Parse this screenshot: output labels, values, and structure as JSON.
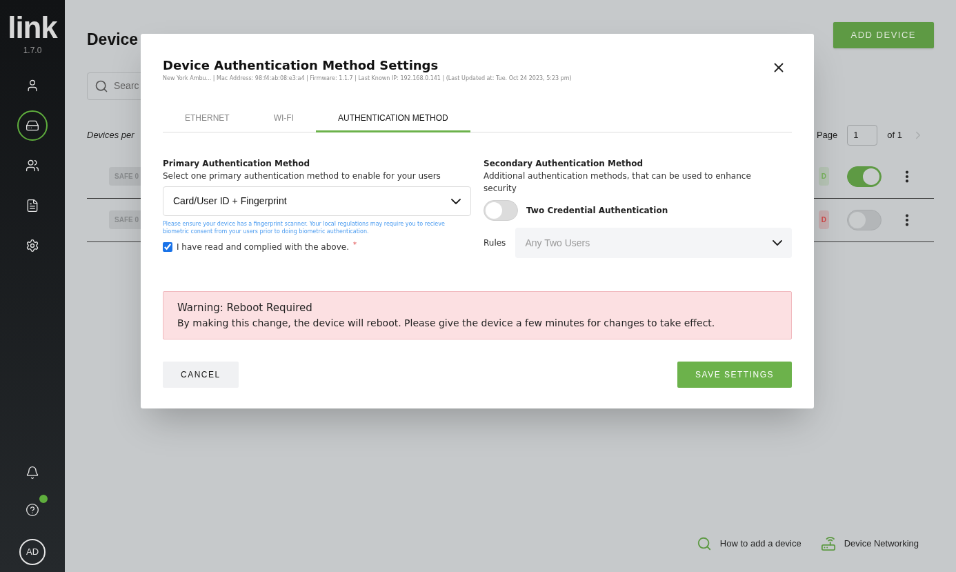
{
  "sidebar": {
    "logo": "link",
    "version": "1.7.0",
    "nav": [
      {
        "kind": "user",
        "selected": false
      },
      {
        "kind": "device",
        "selected": true
      },
      {
        "kind": "users",
        "selected": false
      },
      {
        "kind": "document",
        "selected": false
      },
      {
        "kind": "settings",
        "selected": false
      }
    ],
    "bottom": [
      {
        "kind": "bell",
        "dot": false
      },
      {
        "kind": "help",
        "dot": true
      }
    ],
    "avatar": "AD"
  },
  "page": {
    "title": "Device",
    "add_button": "ADD DEVICE",
    "search_placeholder": "Searc",
    "per_page_label": "Devices per",
    "pagination": {
      "label": "Page",
      "value": "1",
      "of": "of 1"
    },
    "rows": [
      {
        "badge": "SAFE 0",
        "status": "D",
        "color": "#79b45e",
        "enabled": true
      },
      {
        "badge": "SAFE 0",
        "status": "D",
        "color": "#d04848",
        "enabled": false
      }
    ],
    "footer_links": [
      {
        "kind": "search",
        "label": "How to add a device"
      },
      {
        "kind": "router",
        "label": "Device Networking"
      }
    ]
  },
  "modal": {
    "title": "Device Authentication Method Settings",
    "subtitle": "New York Ambu... | Mac Address: 98:f4:ab:08:e3:a4 | Firmware: 1.1.7 | Last Known IP: 192.168.0.141 | (Last Updated at: Tue. Oct 24 2023, 5:23 pm)",
    "tabs": [
      {
        "label": "ETHERNET",
        "selected": false
      },
      {
        "label": "WI-FI",
        "selected": false
      },
      {
        "label": "AUTHENTICATION METHOD",
        "selected": true
      }
    ],
    "primary": {
      "heading": "Primary Authentication Method",
      "description": "Select one primary authentication method to enable for your users",
      "value": "Card/User ID + Fingerprint",
      "note": "Please ensure your device has a fingerprint scanner. Your local regulations may require you to recieve biometric consent from your users prior to doing biometric authentication.",
      "checkbox_label": "I have read and complied with the above.",
      "checked": true,
      "required_mark": "*"
    },
    "secondary": {
      "heading": "Secondary Authentication Method",
      "description": "Additional authentication methods, that can be used to enhance security",
      "toggle_label": "Two Credential Authentication",
      "on": false,
      "rules_label": "Rules",
      "rules_placeholder": "Any Two Users"
    },
    "warning": {
      "title": "Warning: Reboot Required",
      "text": "By making this change, the device will reboot. Please give the device a few minutes for changes to take effect."
    },
    "cancel": "CANCEL",
    "save": "SAVE SETTINGS"
  }
}
